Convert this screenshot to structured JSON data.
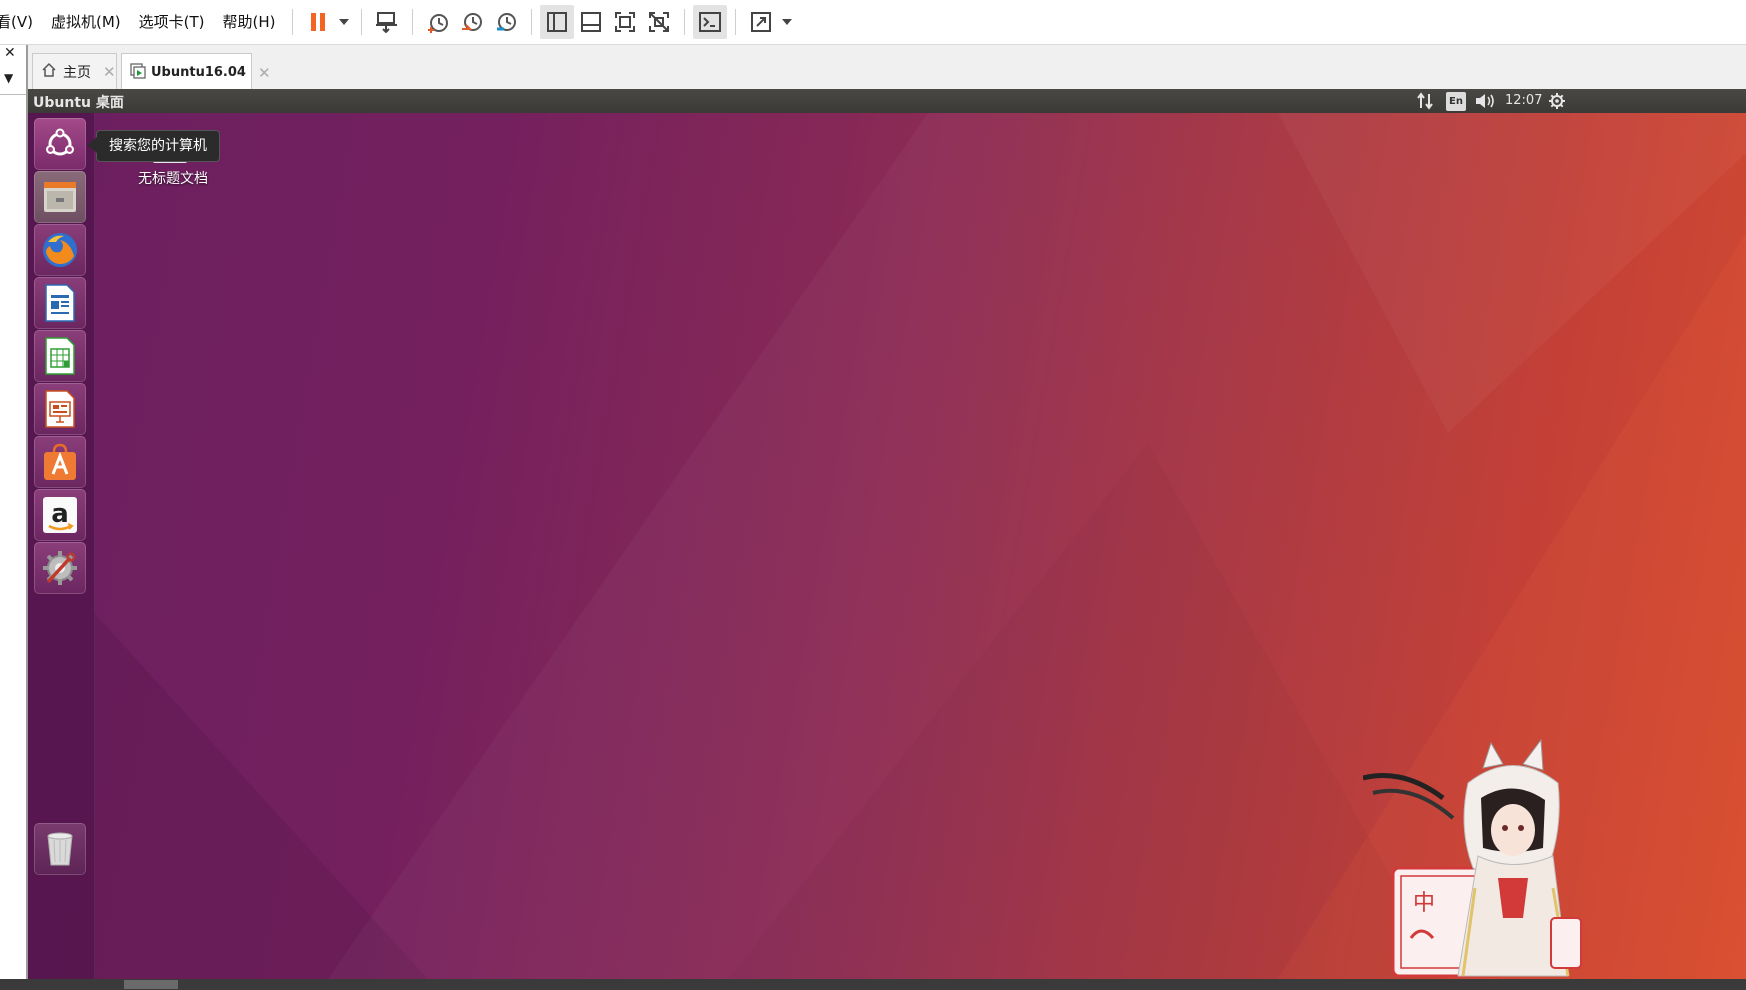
{
  "menubar": {
    "items": [
      {
        "label": "看(V)",
        "name": "menu-view"
      },
      {
        "label": "虚拟机(M)",
        "name": "menu-vm"
      },
      {
        "label": "选项卡(T)",
        "name": "menu-tabs"
      },
      {
        "label": "帮助(H)",
        "name": "menu-help"
      }
    ]
  },
  "toolbar": {
    "icons": [
      "pause-icon",
      "dropdown-arrow-icon",
      "send-ctrl-alt-del-icon",
      "snapshot-icon",
      "revert-snapshot-icon",
      "snapshot-manager-icon",
      "library-view-icon",
      "thumbnail-bar-icon",
      "fullscreen-icon",
      "unity-mode-icon",
      "console-view-icon",
      "stretch-guest-icon",
      "dropdown-arrow-icon"
    ]
  },
  "leftpane": {
    "close_glyph": "✕",
    "dropdown_glyph": "▼"
  },
  "tabs": [
    {
      "label": "主页",
      "icon": "home-icon",
      "close": "✕"
    },
    {
      "label": "Ubuntu16.04",
      "icon": "vm-tab-icon",
      "close": "✕",
      "active": true
    }
  ],
  "guest_topbar": {
    "title": "Ubuntu 桌面",
    "lang": "En",
    "time": "12:07",
    "icons": [
      "network-updown-icon",
      "keyboard-lang-icon",
      "volume-icon",
      "system-gear-icon"
    ]
  },
  "desktop": {
    "file_icon_label": "无标题文档",
    "tooltip": "搜索您的计算机"
  },
  "launcher": {
    "items": [
      "ubuntu-dash-icon",
      "files-icon",
      "firefox-icon",
      "libreoffice-writer-icon",
      "libreoffice-calc-icon",
      "libreoffice-impress-icon",
      "software-center-icon",
      "amazon-icon",
      "system-settings-icon"
    ],
    "trash": "trash-icon"
  },
  "colors": {
    "pause": "#f26522",
    "desktop_gradient": [
      "#6b1f60",
      "#8a2a55",
      "#c13a30",
      "#d5462a"
    ]
  }
}
